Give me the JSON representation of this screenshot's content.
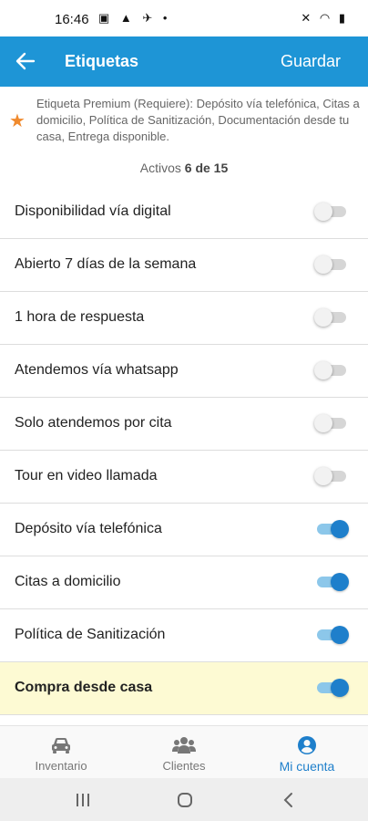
{
  "status_bar": {
    "time": "16:46",
    "left_icons": "▣ ▲ ✈ •",
    "right_icons": "✕ ◠ ▮"
  },
  "app_bar": {
    "title": "Etiquetas",
    "save_label": "Guardar",
    "color": "#1e95d6"
  },
  "premium": {
    "icon": "star-icon",
    "text": "Etiqueta Premium (Requiere): Depósito vía telefónica, Citas a domicilio, Política de Sanitización, Documentación desde tu casa, Entrega disponible."
  },
  "count": {
    "label": "Activos",
    "value": "6 de 15"
  },
  "tags": [
    {
      "label": "Disponibilidad vía digital",
      "on": false
    },
    {
      "label": "Abierto 7 días de la semana",
      "on": false
    },
    {
      "label": "1 hora de respuesta",
      "on": false
    },
    {
      "label": "Atendemos vía whatsapp",
      "on": false
    },
    {
      "label": "Solo atendemos por cita",
      "on": false
    },
    {
      "label": "Tour en video llamada",
      "on": false
    },
    {
      "label": "Depósito vía telefónica",
      "on": true
    },
    {
      "label": "Citas a domicilio",
      "on": true
    },
    {
      "label": "Política de Sanitización",
      "on": true
    },
    {
      "label": "Compra desde casa",
      "on": true,
      "highlight": true
    }
  ],
  "bottom_nav": {
    "items": [
      {
        "label": "Inventario",
        "icon": "car-icon"
      },
      {
        "label": "Clientes",
        "icon": "users-icon"
      },
      {
        "label": "Mi cuenta",
        "icon": "account-icon",
        "active": true
      }
    ],
    "active_color": "#1e7fcb"
  }
}
